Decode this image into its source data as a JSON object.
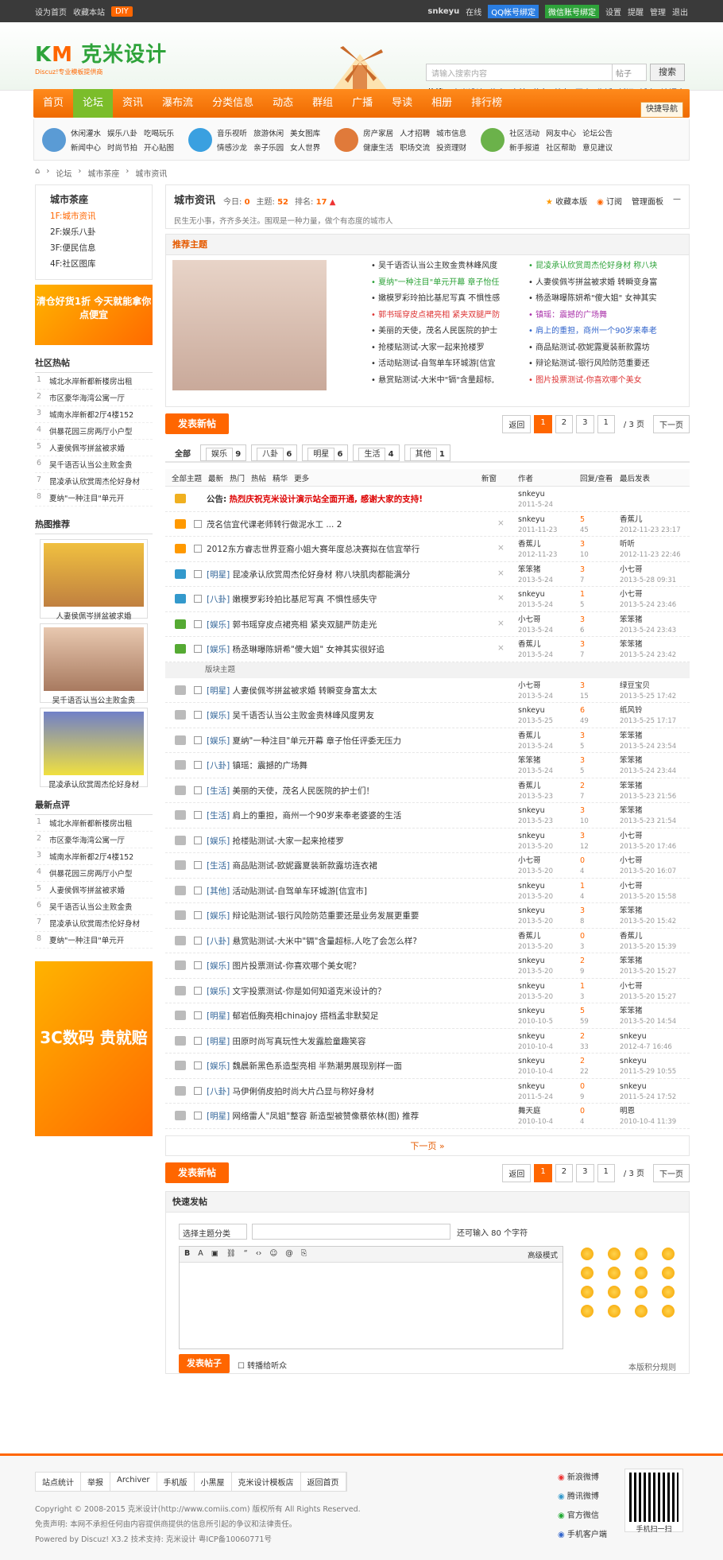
{
  "topbar": {
    "sethome": "设为首页",
    "fav": "收藏本站",
    "diy": "DIY",
    "user": "snkeyu",
    "online": "在线",
    "qq": "QQ帐号绑定",
    "wx": "微信账号绑定",
    "settings": "设置",
    "remind": "提醒",
    "manage": "管理",
    "logout": "退出"
  },
  "header": {
    "logo": "克米设计",
    "logo_sub": "Discuz!专业模板提供商",
    "search_placeholder": "请输入搜索内容",
    "search_type": "帖子",
    "search_btn": "搜索",
    "hot_label": "热搜:",
    "hot": [
      "克米设计",
      "信宜",
      "自拍",
      "茂名",
      "美女",
      "写真",
      "生活",
      "新闻",
      "城市",
      "清调会"
    ]
  },
  "nav": {
    "items": [
      "首页",
      "论坛",
      "资讯",
      "瀑布流",
      "分类信息",
      "动态",
      "群组",
      "广播",
      "导读",
      "相册",
      "排行榜"
    ],
    "quick": "快捷导航"
  },
  "subnav": [
    [
      "休闲灌水",
      "娱乐八卦",
      "吃喝玩乐",
      "新闻中心",
      "时尚节拍",
      "开心贴图"
    ],
    [
      "音乐视听",
      "旅游休闲",
      "美女图库",
      "情感沙龙",
      "亲子乐园",
      "女人世界"
    ],
    [
      "房产家居",
      "人才招聘",
      "城市信息",
      "健康生活",
      "职场交流",
      "投资理财"
    ],
    [
      "社区活动",
      "网友中心",
      "论坛公告",
      "新手报道",
      "社区帮助",
      "意见建议"
    ]
  ],
  "crumb": [
    "论坛",
    "城市茶座",
    "城市资讯"
  ],
  "side": {
    "cat_title": "城市茶座",
    "cats": [
      "1F:城市资讯",
      "2F:娱乐八卦",
      "3F:便民信息",
      "4F:社区图库"
    ],
    "ad": "清仓好货1折 今天就能拿你点便宜",
    "hot_title": "社区热帖",
    "hot": [
      "城北水岸新都新楼房出租",
      "市区豪华海湾公寓一厅",
      "城南水岸新都2厅4楼152",
      "供暴花园三房两厅小户型",
      "人妻侯佩岑拼盆被求婚",
      "吴千语否认当公主败金贵",
      "昆凌承认欣赏周杰伦好身材",
      "夏纳\"一种注目\"单元开"
    ],
    "rec_title": "热图推荐",
    "pics": [
      "人妻侯佩岑拼盆被求婚",
      "吴千语否认当公主败金贵",
      "昆凌承认欣赏周杰伦好身材"
    ],
    "new_title": "最新点评",
    "new": [
      "城北水岸新都新楼房出租",
      "市区豪华海湾公寓一厅",
      "城南水岸新都2厅4楼152",
      "供暴花园三房两厅小户型",
      "人妻侯佩岑拼盆被求婚",
      "吴千语否认当公主败金贵",
      "昆凌承认欣赏周杰伦好身材",
      "夏纳\"一种注目\"单元开"
    ],
    "ad2": "3C数码 贵就赔"
  },
  "forum": {
    "title": "城市资讯",
    "today_label": "今日:",
    "today": "0",
    "topics_label": "主题:",
    "topics": "52",
    "rank_label": "排名:",
    "rank": "17",
    "desc": "民生无小事，齐齐多关注。围观是一种力量，做个有态度的城市人",
    "fav": "收藏本版",
    "rss": "订阅",
    "admin": "管理面板"
  },
  "rec": {
    "title": "推荐主题",
    "items": [
      "吴千语否认当公主败金贵林峰风度",
      "昆凌承认欣赏周杰伦好身材 称八块",
      "夏纳\"一种注目\"单元开幕 章子怡任",
      "人妻侯佩岑拼盆被求婚 转瞬变身富",
      "嫩模罗彩玲拍比基尼写真 不惧性感",
      "杨丞琳曝陈妍希\"傻大姐\" 女神其实",
      "郭书瑶穿皮点裙亮相 紧夹双腿严防",
      "镇瑶：震撼的广场舞",
      "美丽的天使，茂名人民医院的护士",
      "肩上的重担，商州一个90岁来奉老",
      "抢楼贴测试-大家一起来抢楼罗",
      "商品贴测试-欧妮露夏装新款露坊",
      "活动贴测试-自驾单车环城游[信宜",
      "辩论贴测试-银行风险防范重要还",
      "悬赏贴测试-大米中\"镉\"含量超标,",
      "图片投票测试-你喜欢哪个美女"
    ]
  },
  "pager": {
    "post": "发表新帖",
    "prev": "返回",
    "pages": [
      "1",
      "2",
      "3"
    ],
    "cur": "1",
    "total": "/ 3 页",
    "next": "下一页"
  },
  "types": [
    {
      "l": "全部",
      "c": ""
    },
    {
      "l": "娱乐",
      "c": "9"
    },
    {
      "l": "八卦",
      "c": "6"
    },
    {
      "l": "明星",
      "c": "6"
    },
    {
      "l": "生活",
      "c": "4"
    },
    {
      "l": "其他",
      "c": "1"
    }
  ],
  "thead": {
    "filters": [
      "全部主题",
      "最新",
      "热门",
      "热帖",
      "精华",
      "更多"
    ],
    "newwin": "新窗",
    "author": "作者",
    "reply": "回复/查看",
    "last": "最后发表"
  },
  "notice": {
    "label": "公告:",
    "title": "热烈庆祝克米设计演示站全面开通, 感谢大家的支持!",
    "author": "snkeyu",
    "date": "2011-5-24"
  },
  "sticky": [
    {
      "cat": "",
      "title": "茂名信宜代课老师转行做泥水工",
      "extra": "... 2",
      "au": "snkeyu",
      "ad": "2011-11-23",
      "r": "5",
      "v": "45",
      "lu": "香蕉儿",
      "ld": "2012-11-23 23:17"
    },
    {
      "cat": "",
      "title": "2012东方睿志世界亚裔小姐大赛年度总决赛拟在信宜举行",
      "extra": "",
      "au": "香蕉儿",
      "ad": "2012-11-23",
      "r": "3",
      "v": "10",
      "lu": "听听",
      "ld": "2012-11-23 22:46"
    },
    {
      "cat": "[明星]",
      "title": "昆凌承认欣赏周杰伦好身材 称八块肌肉都能满分",
      "extra": "",
      "au": "笨笨猪",
      "ad": "2013-5-24",
      "r": "3",
      "v": "7",
      "lu": "小七哥",
      "ld": "2013-5-28 09:31"
    },
    {
      "cat": "[八卦]",
      "title": "嫩模罗彩玲拍比基尼写真 不惧性感失守",
      "extra": "",
      "au": "snkeyu",
      "ad": "2013-5-24",
      "r": "1",
      "v": "5",
      "lu": "小七哥",
      "ld": "2013-5-24 23:46"
    },
    {
      "cat": "[娱乐]",
      "title": "郭书瑶穿皮点裙亮相 紧夹双腿严防走光",
      "extra": "",
      "au": "小七哥",
      "ad": "2013-5-24",
      "r": "3",
      "v": "6",
      "lu": "笨笨猪",
      "ld": "2013-5-24 23:43"
    },
    {
      "cat": "[娱乐]",
      "title": "杨丞琳曝陈妍希\"傻大姐\" 女神其实很好追",
      "extra": "",
      "au": "香蕉儿",
      "ad": "2013-5-24",
      "r": "3",
      "v": "7",
      "lu": "笨笨猪",
      "ld": "2013-5-24 23:42"
    }
  ],
  "sep": "版块主题",
  "threads": [
    {
      "cat": "[明星]",
      "title": "人妻侯佩岑拼盆被求婚 转瞬变身富太太",
      "au": "小七哥",
      "ad": "2013-5-24",
      "r": "3",
      "v": "15",
      "lu": "绿豆宝贝",
      "ld": "2013-5-25 17:42"
    },
    {
      "cat": "[娱乐]",
      "title": "吴千语否认当公主败金贵林峰风度男友",
      "au": "snkeyu",
      "ad": "2013-5-25",
      "r": "6",
      "v": "49",
      "lu": "纸风铃",
      "ld": "2013-5-25 17:17"
    },
    {
      "cat": "[娱乐]",
      "title": "夏纳\"一种注目\"单元开幕 章子怡任评委无压力",
      "au": "香蕉儿",
      "ad": "2013-5-24",
      "r": "3",
      "v": "5",
      "lu": "笨笨猪",
      "ld": "2013-5-24 23:54"
    },
    {
      "cat": "[八卦]",
      "title": "镇瑶：震撼的广场舞",
      "au": "笨笨猪",
      "ad": "2013-5-24",
      "r": "3",
      "v": "5",
      "lu": "笨笨猪",
      "ld": "2013-5-24 23:44"
    },
    {
      "cat": "[生活]",
      "title": "美丽的天使，茂名人民医院的护士们！",
      "au": "香蕉儿",
      "ad": "2013-5-23",
      "r": "2",
      "v": "7",
      "lu": "笨笨猪",
      "ld": "2013-5-23 21:56"
    },
    {
      "cat": "[生活]",
      "title": "肩上的重担，商州一个90岁来奉老婆婆的生活",
      "au": "snkeyu",
      "ad": "2013-5-23",
      "r": "3",
      "v": "10",
      "lu": "笨笨猪",
      "ld": "2013-5-23 21:54"
    },
    {
      "cat": "[娱乐]",
      "title": "抢楼贴测试-大家一起来抢楼罗",
      "au": "snkeyu",
      "ad": "2013-5-20",
      "r": "3",
      "v": "12",
      "lu": "小七哥",
      "ld": "2013-5-20 17:46"
    },
    {
      "cat": "[生活]",
      "title": "商品贴测试-欧妮露夏装新款露坊连衣裙",
      "au": "小七哥",
      "ad": "2013-5-20",
      "r": "0",
      "v": "4",
      "lu": "小七哥",
      "ld": "2013-5-20 16:07"
    },
    {
      "cat": "[其他]",
      "title": "活动贴测试-自驾单车环城游[信宜市]",
      "au": "snkeyu",
      "ad": "2013-5-20",
      "r": "1",
      "v": "4",
      "lu": "小七哥",
      "ld": "2013-5-20 15:58"
    },
    {
      "cat": "[娱乐]",
      "title": "辩论贴测试-银行风险防范重要还是业务发展更重要",
      "au": "snkeyu",
      "ad": "2013-5-20",
      "r": "3",
      "v": "8",
      "lu": "笨笨猪",
      "ld": "2013-5-20 15:42"
    },
    {
      "cat": "[八卦]",
      "title": "悬赏贴测试-大米中\"镉\"含量超标,人吃了会怎么样?",
      "au": "香蕉儿",
      "ad": "2013-5-20",
      "r": "0",
      "v": "3",
      "lu": "香蕉儿",
      "ld": "2013-5-20 15:39"
    },
    {
      "cat": "[娱乐]",
      "title": "图片投票测试-你喜欢哪个美女呢？",
      "au": "snkeyu",
      "ad": "2013-5-20",
      "r": "2",
      "v": "9",
      "lu": "笨笨猪",
      "ld": "2013-5-20 15:27"
    },
    {
      "cat": "[娱乐]",
      "title": "文字投票测试-你是如何知道克米设计的？",
      "au": "snkeyu",
      "ad": "2013-5-20",
      "r": "1",
      "v": "3",
      "lu": "小七哥",
      "ld": "2013-5-20 15:27"
    },
    {
      "cat": "[明星]",
      "title": "郁岩低胸亮相chinajoy 搭档孟非默契足",
      "au": "snkeyu",
      "ad": "2010-10-5",
      "r": "5",
      "v": "59",
      "lu": "笨笨猪",
      "ld": "2013-5-20 14:54"
    },
    {
      "cat": "[明星]",
      "title": "田原时尚写真玩性大发露脸童趣笑容",
      "au": "snkeyu",
      "ad": "2010-10-4",
      "r": "2",
      "v": "33",
      "lu": "snkeyu",
      "ld": "2012-4-7 16:46"
    },
    {
      "cat": "[娱乐]",
      "title": "魏晨新黑色系造型亮相 半熟潮男展现别样一面",
      "au": "snkeyu",
      "ad": "2010-10-4",
      "r": "2",
      "v": "22",
      "lu": "snkeyu",
      "ld": "2011-5-29 10:55"
    },
    {
      "cat": "[八卦]",
      "title": "马伊俐俏皮拍时尚大片凸显与称好身材",
      "au": "snkeyu",
      "ad": "2011-5-24",
      "r": "0",
      "v": "9",
      "lu": "snkeyu",
      "ld": "2011-5-24 17:52"
    },
    {
      "cat": "[明星]",
      "title": "网络雷人\"凤姐\"整容 新造型被赞像蔡依林(图) 推荐",
      "au": "舞天庭",
      "ad": "2010-10-4",
      "r": "0",
      "v": "4",
      "lu": "明恩",
      "ld": "2010-10-4 11:39"
    }
  ],
  "nextpage": "下一页 »",
  "quick": {
    "title": "快速发帖",
    "sel": "选择主题分类",
    "limit": "还可输入 80 个字符",
    "adv": "高级模式",
    "submit": "发表帖子",
    "sync": "转播给听众",
    "rule": "本版积分规则"
  },
  "footer": {
    "links": [
      "站点统计",
      "举报",
      "Archiver",
      "手机版",
      "小黑屋",
      "克米设计模板店",
      "返回首页"
    ],
    "copy": "Copyright © 2008-2015 克米设计(http://www.comiis.com) 版权所有 All Rights Reserved.",
    "disclaimer": "免责声明: 本网不承担任何由内容提供商提供的信息所引起的争议和法律责任。",
    "powered": "Powered by Discuz! X3.2  技术支持: 克米设计 粤ICP备10060771号",
    "social": [
      "新浪微博",
      "腾讯微博",
      "官方微信",
      "手机客户端"
    ],
    "qr": "手机扫一扫"
  }
}
